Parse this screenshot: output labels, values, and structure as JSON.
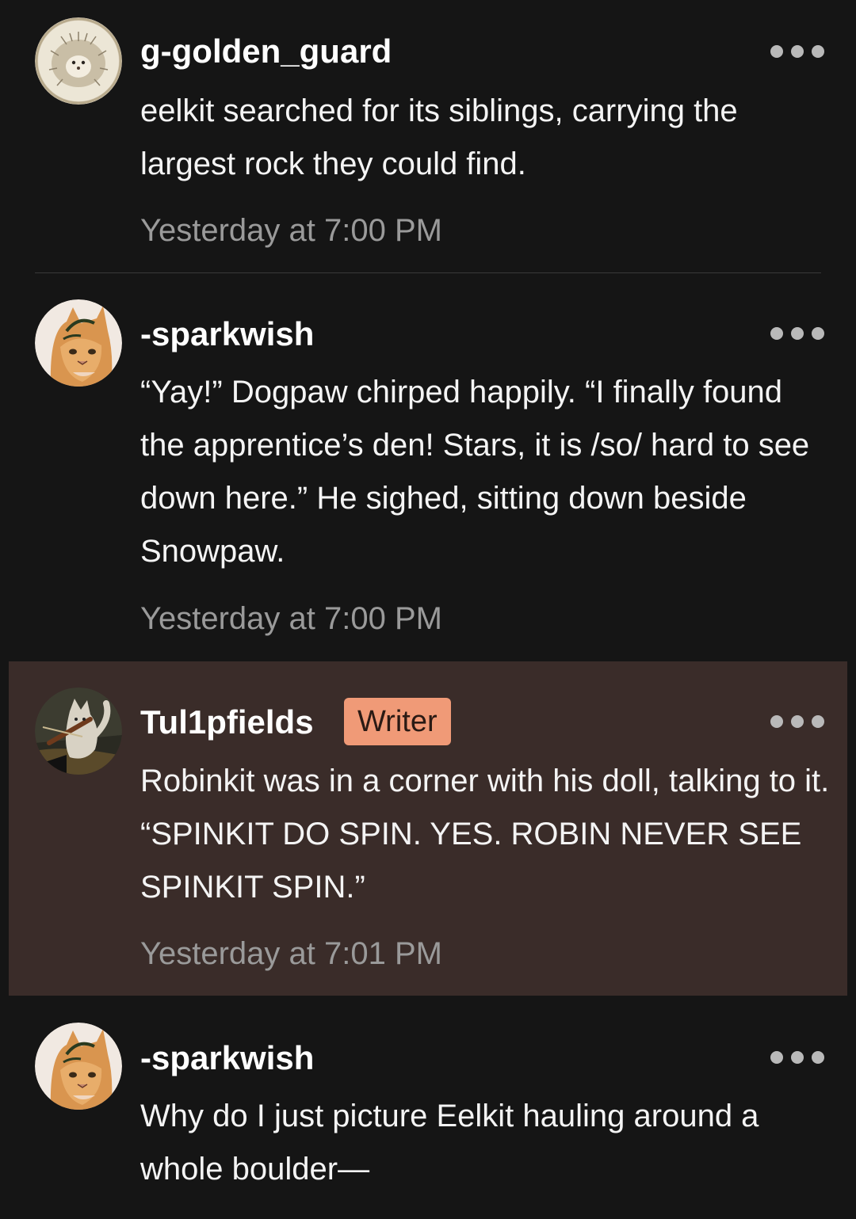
{
  "comments": [
    {
      "username": "g-golden_guard",
      "avatar_icon": "hedgehog-avatar",
      "text": "eelkit searched for its siblings, carrying the largest rock they could find.",
      "timestamp": "Yesterday at 7:00 PM"
    },
    {
      "username": "-sparkwish",
      "avatar_icon": "orange-cat-avatar",
      "text": "“Yay!” Dogpaw chirped happily. “I finally found the apprentice’s den! Stars, it is /so/ hard to see down here.” He sighed, sitting down beside Snowpaw.",
      "timestamp": "Yesterday at 7:00 PM"
    },
    {
      "username": "Tul1pfields",
      "badge": "Writer",
      "avatar_icon": "violin-cat-avatar",
      "text": "Robinkit was in a corner with his doll, talking to it. “SPINKIT DO SPIN. YES. ROBIN NEVER SEE SPINKIT SPIN.”",
      "timestamp": "Yesterday at 7:01 PM"
    },
    {
      "username": "-sparkwish",
      "avatar_icon": "orange-cat-avatar",
      "text": "Why do I just picture Eelkit hauling around a whole boulder—"
    }
  ],
  "colors": {
    "background": "#151515",
    "highlight_background": "#3a2c29",
    "badge_background": "#f09a77",
    "timestamp": "#9a9a9a"
  }
}
